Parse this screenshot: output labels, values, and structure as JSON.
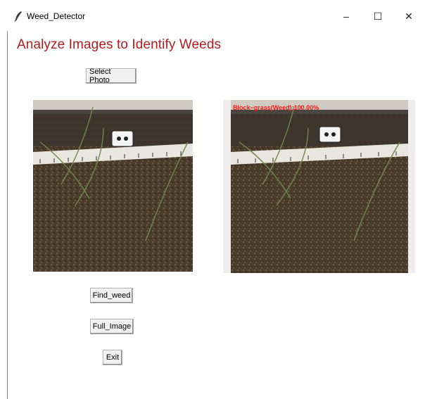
{
  "window": {
    "title": "Weed_Detector",
    "controls": {
      "minimize": "–",
      "maximize": "☐",
      "close": "✕"
    }
  },
  "heading": "Analyze Images to Identify Weeds",
  "buttons": {
    "select_photo": "Select Photo",
    "find_weed": "Find_weed",
    "full_image": "Full_Image",
    "exit": "Exit"
  },
  "result": {
    "detection_label": "Block−grass(Weed):100.00%"
  },
  "colors": {
    "heading": "#b31d22",
    "detection_label": "#ff1a1a"
  }
}
